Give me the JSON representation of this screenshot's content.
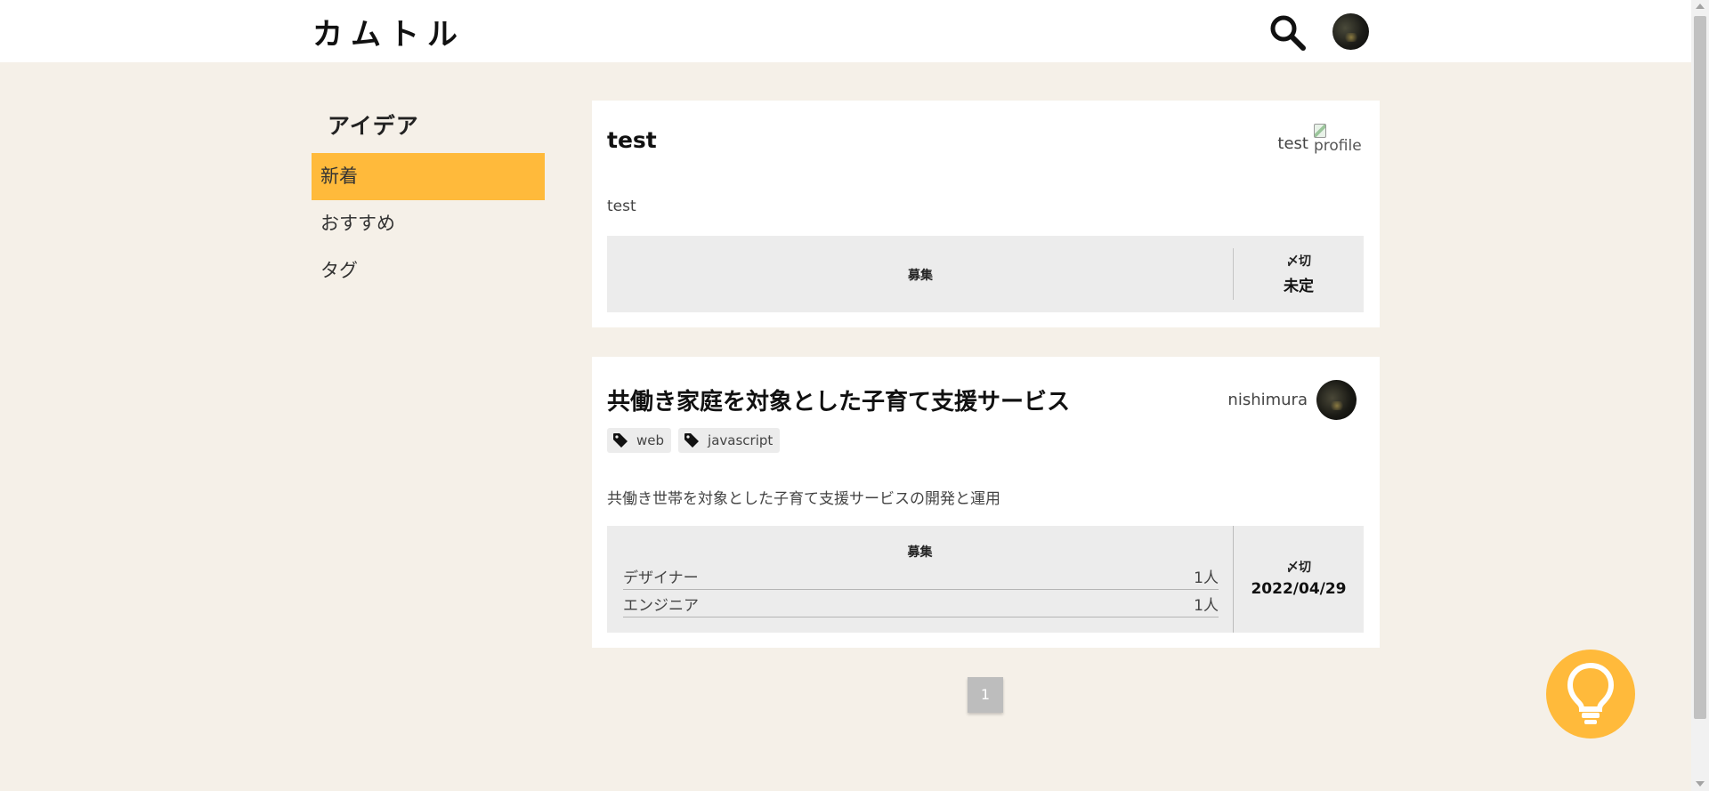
{
  "header": {
    "logo": "カムトル",
    "search_icon": "search-icon",
    "avatar": "user-avatar"
  },
  "sidebar": {
    "title": "アイデア",
    "items": [
      {
        "label": "新着",
        "active": true
      },
      {
        "label": "おすすめ",
        "active": false
      },
      {
        "label": "タグ",
        "active": false
      }
    ]
  },
  "posts": [
    {
      "title": "test",
      "author": "test",
      "author_img_alt": "profile",
      "tags": [],
      "description": "test",
      "recruit_label": "募集",
      "roles": [],
      "deadline_label": "〆切",
      "deadline_value": "未定"
    },
    {
      "title": "共働き家庭を対象とした子育て支援サービス",
      "author": "nishimura",
      "tags": [
        "web",
        "javascript"
      ],
      "description": "共働き世帯を対象とした子育て支援サービスの開発と運用",
      "recruit_label": "募集",
      "roles": [
        {
          "name": "デザイナー",
          "count": "1人"
        },
        {
          "name": "エンジニア",
          "count": "1人"
        }
      ],
      "deadline_label": "〆切",
      "deadline_value": "2022/04/29"
    }
  ],
  "pagination": {
    "current": "1"
  },
  "fab": {
    "icon": "lightbulb-icon"
  },
  "colors": {
    "accent": "#ffba3b",
    "background": "#f5f0e8",
    "info_box": "#ececec"
  }
}
